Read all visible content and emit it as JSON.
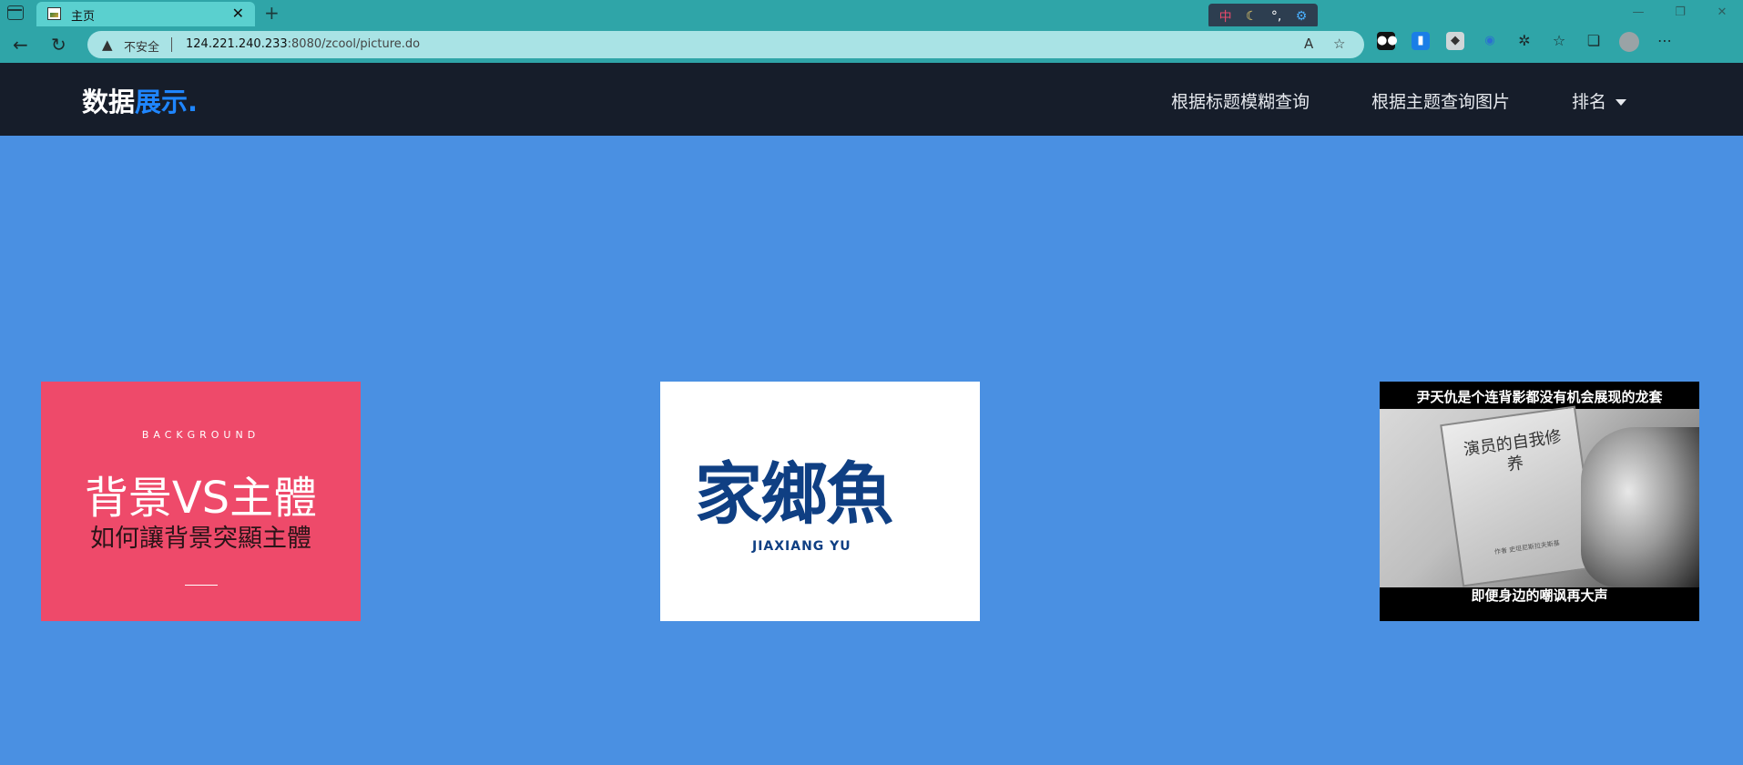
{
  "browser": {
    "tab_title": "主页",
    "tab_close": "✕",
    "new_tab": "+",
    "window_buttons": [
      "—",
      "❐",
      "✕"
    ],
    "address": {
      "security_label": "不安全",
      "url_host": "124.221.240.233",
      "url_path": ":8080/zcool/picture.do"
    },
    "ime": [
      "中",
      "☾",
      "°,",
      "⚙"
    ]
  },
  "site": {
    "brand_part1": "数据",
    "brand_part2": "展示.",
    "nav": {
      "fuzzy_title": "根据标题模糊查询",
      "by_topic": "根据主题查询图片",
      "ranking": "排名"
    }
  },
  "cards": [
    {
      "eyebrow": "BACKGROUND",
      "title": "背景VS主體",
      "subtitle": "如何讓背景突顯主體"
    },
    {
      "logo": "家鄉魚",
      "latin": "JIAXIANG  YU"
    },
    {
      "top_caption": "尹天仇是个连背影都没有机会展现的龙套",
      "book_title": "演员的自我修养",
      "book_small": "作者 史坦尼斯拉夫斯基",
      "bottom_caption": "即便身边的嘲讽再大声"
    }
  ],
  "colors": {
    "page_bg": "#4a90e2",
    "nav_bg": "#161d2a",
    "brand_accent": "#1f86ff",
    "card1_bg": "#ee4a6a",
    "logo_blue": "#0f3f83"
  }
}
